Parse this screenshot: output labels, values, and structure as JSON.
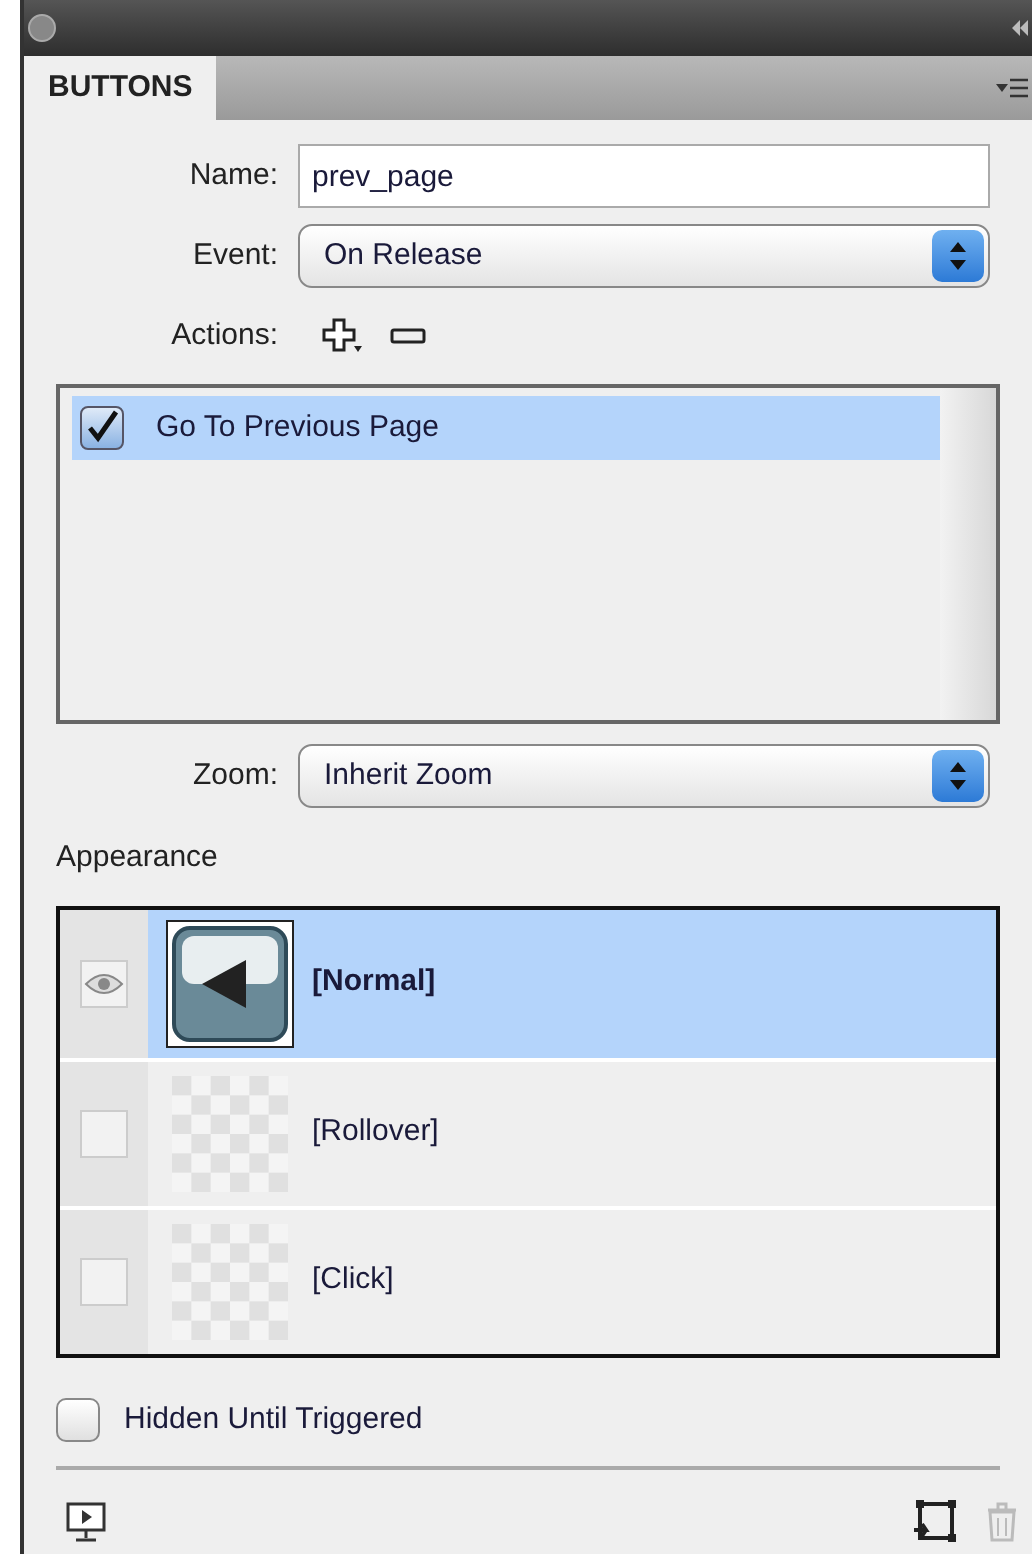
{
  "tab": {
    "label": "BUTTONS",
    "selected": true
  },
  "name_field": {
    "label": "Name:",
    "value": "prev_page"
  },
  "event_select": {
    "label": "Event:",
    "value": "On Release"
  },
  "actions": {
    "label": "Actions:",
    "items": [
      {
        "label": "Go To Previous Page",
        "checked": true,
        "selected": true
      }
    ]
  },
  "zoom_select": {
    "label": "Zoom:",
    "value": "Inherit Zoom"
  },
  "appearance": {
    "title": "Appearance",
    "states": [
      {
        "label": "[Normal]",
        "visible": true,
        "selected": true,
        "kind": "button"
      },
      {
        "label": "[Rollover]",
        "visible": false,
        "selected": false,
        "kind": "empty"
      },
      {
        "label": "[Click]",
        "visible": false,
        "selected": false,
        "kind": "empty"
      }
    ]
  },
  "hidden_until_triggered": {
    "label": "Hidden Until Triggered",
    "checked": false
  }
}
